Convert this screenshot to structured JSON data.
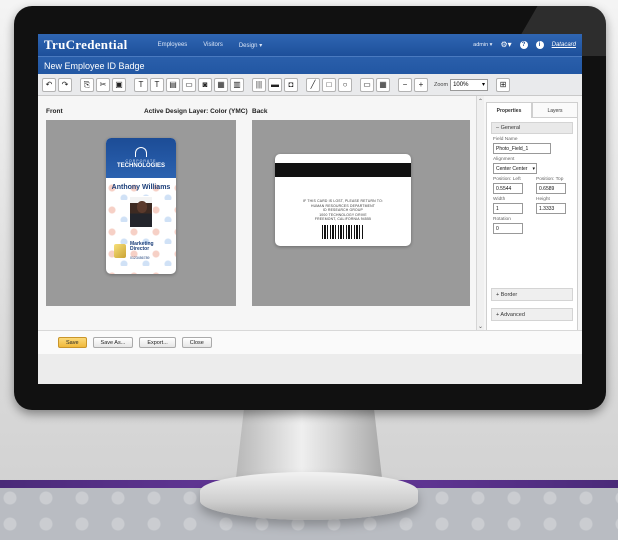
{
  "app": {
    "logo": "TruCredential",
    "nav": [
      "Employees",
      "Visitors",
      "Design ▾"
    ],
    "user": "admin ▾",
    "brand_link": "Datacard",
    "page_title": "New Employee ID Badge"
  },
  "toolbar": {
    "buttons": [
      "undo-icon",
      "redo-icon",
      "copy-icon",
      "cut-icon",
      "paste-icon",
      "text-box-icon",
      "text-icon",
      "text-field-icon",
      "image-icon",
      "photo-icon",
      "photo-field-icon",
      "image-field-icon",
      "barcode-icon",
      "magstripe-icon",
      "chip-icon",
      "line-icon",
      "rectangle-icon",
      "ellipse-icon",
      "small-box-icon",
      "grid-icon",
      "zoom-out-icon",
      "zoom-in-icon",
      "layout-icon"
    ],
    "zoom_label": "Zoom",
    "zoom_value": "100%"
  },
  "canvas": {
    "front_label": "Front",
    "layer_label": "Active Design Layer: Color (YMC)",
    "back_label": "Back"
  },
  "front_card": {
    "company_line1": "CORPORATE",
    "company_line2": "TECHNOLOGIES",
    "name": "Anthony Williams",
    "role_line1": "Marketing",
    "role_line2": "Director",
    "id_number": "0123456789"
  },
  "back_card": {
    "lines": [
      "IF THIS CARD IS LOST, PLEASE RETURN TO:",
      "HUMAN RESOURCES DEPARTMENT",
      "ID RESEARCH GROUP",
      "1000 TECHNOLOGY DRIVE",
      "FREEMONT, CALIFORNIA 94555"
    ]
  },
  "properties": {
    "tabs": [
      "Properties",
      "Layers"
    ],
    "general_header": "– General",
    "field_name_label": "Field Name",
    "field_name_value": "Photo_Field_1",
    "alignment_label": "Alignment",
    "alignment_value": "Center Center",
    "pos_left_label": "Position: Left",
    "pos_left_value": "0.5544",
    "pos_top_label": "Position: Top",
    "pos_top_value": "0.6589",
    "width_label": "Width",
    "width_value": "1",
    "height_label": "Height",
    "height_value": "1.3333",
    "rotation_label": "Rotation",
    "rotation_value": "0",
    "border_header": "+ Border",
    "advanced_header": "+ Advanced"
  },
  "footer": {
    "save": "Save",
    "save_as": "Save As...",
    "export": "Export...",
    "close": "Close"
  }
}
